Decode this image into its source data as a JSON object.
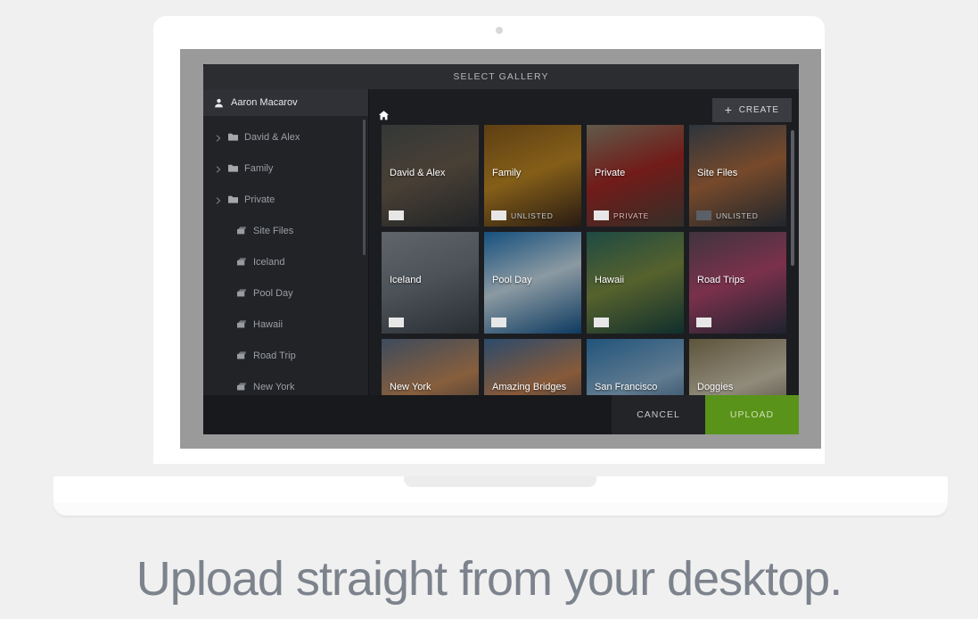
{
  "caption": "Upload straight from your desktop.",
  "app": {
    "title": "SELECT GALLERY",
    "user": {
      "name": "Aaron Macarov",
      "icon": "user-icon"
    },
    "toolbar": {
      "home_icon": "home-icon",
      "create_label": "CREATE",
      "create_icon": "plus-icon"
    },
    "sidebar": {
      "items": [
        {
          "label": "David & Alex",
          "type": "folder",
          "expandable": true
        },
        {
          "label": "Family",
          "type": "folder",
          "expandable": true
        },
        {
          "label": "Private",
          "type": "folder",
          "expandable": true
        },
        {
          "label": "Site Files",
          "type": "gallery",
          "expandable": false
        },
        {
          "label": "Iceland",
          "type": "gallery",
          "expandable": false
        },
        {
          "label": "Pool Day",
          "type": "gallery",
          "expandable": false
        },
        {
          "label": "Hawaii",
          "type": "gallery",
          "expandable": false
        },
        {
          "label": "Road Trip",
          "type": "gallery",
          "expandable": false
        },
        {
          "label": "New York",
          "type": "gallery",
          "expandable": false
        }
      ]
    },
    "galleries": [
      {
        "title": "David & Alex",
        "badge": "",
        "chip": "light",
        "c1": "#4a4f4c",
        "c2": "#6b5b4a",
        "c3": "#2e3233"
      },
      {
        "title": "Family",
        "badge": "UNLISTED",
        "chip": "light",
        "c1": "#8a5a16",
        "c2": "#c58a1e",
        "c3": "#3a2416"
      },
      {
        "title": "Private",
        "badge": "PRIVATE",
        "chip": "light",
        "c1": "#8d8468",
        "c2": "#a8241f",
        "c3": "#4b4336"
      },
      {
        "title": "Site Files",
        "badge": "UNLISTED",
        "chip": "dark",
        "c1": "#414b56",
        "c2": "#b06a3a",
        "c3": "#2c333c"
      },
      {
        "title": "Iceland",
        "badge": "",
        "chip": "light",
        "c1": "#8d9499",
        "c2": "#6e777e",
        "c3": "#3a4046"
      },
      {
        "title": "Pool Day",
        "badge": "",
        "chip": "light",
        "c1": "#1d74b8",
        "c2": "#cfe3ee",
        "c3": "#10538c"
      },
      {
        "title": "Hawaii",
        "badge": "",
        "chip": "light",
        "c1": "#2a6b5e",
        "c2": "#7f8f3e",
        "c3": "#14413c"
      },
      {
        "title": "Road Trips",
        "badge": "",
        "chip": "light",
        "c1": "#5d4a58",
        "c2": "#b6456b",
        "c3": "#2a2f41"
      },
      {
        "title": "New York",
        "badge": "",
        "chip": "",
        "c1": "#5a6d86",
        "c2": "#c98a55",
        "c3": "#26303d"
      },
      {
        "title": "Amazing Bridges",
        "badge": "",
        "chip": "",
        "c1": "#3f6c9c",
        "c2": "#c9834f",
        "c3": "#1d3350"
      },
      {
        "title": "San Francisco",
        "badge": "",
        "chip": "",
        "c1": "#2f7ab4",
        "c2": "#8fb6d4",
        "c3": "#143d63"
      },
      {
        "title": "Doggies",
        "badge": "",
        "chip": "",
        "c1": "#8a7a52",
        "c2": "#d8cdb4",
        "c3": "#4a4032"
      }
    ],
    "footer": {
      "cancel_label": "CANCEL",
      "upload_label": "UPLOAD"
    }
  },
  "colors": {
    "accent_green": "#59931a",
    "title_bar": "#2b2d31",
    "sidebar": "#212327"
  }
}
